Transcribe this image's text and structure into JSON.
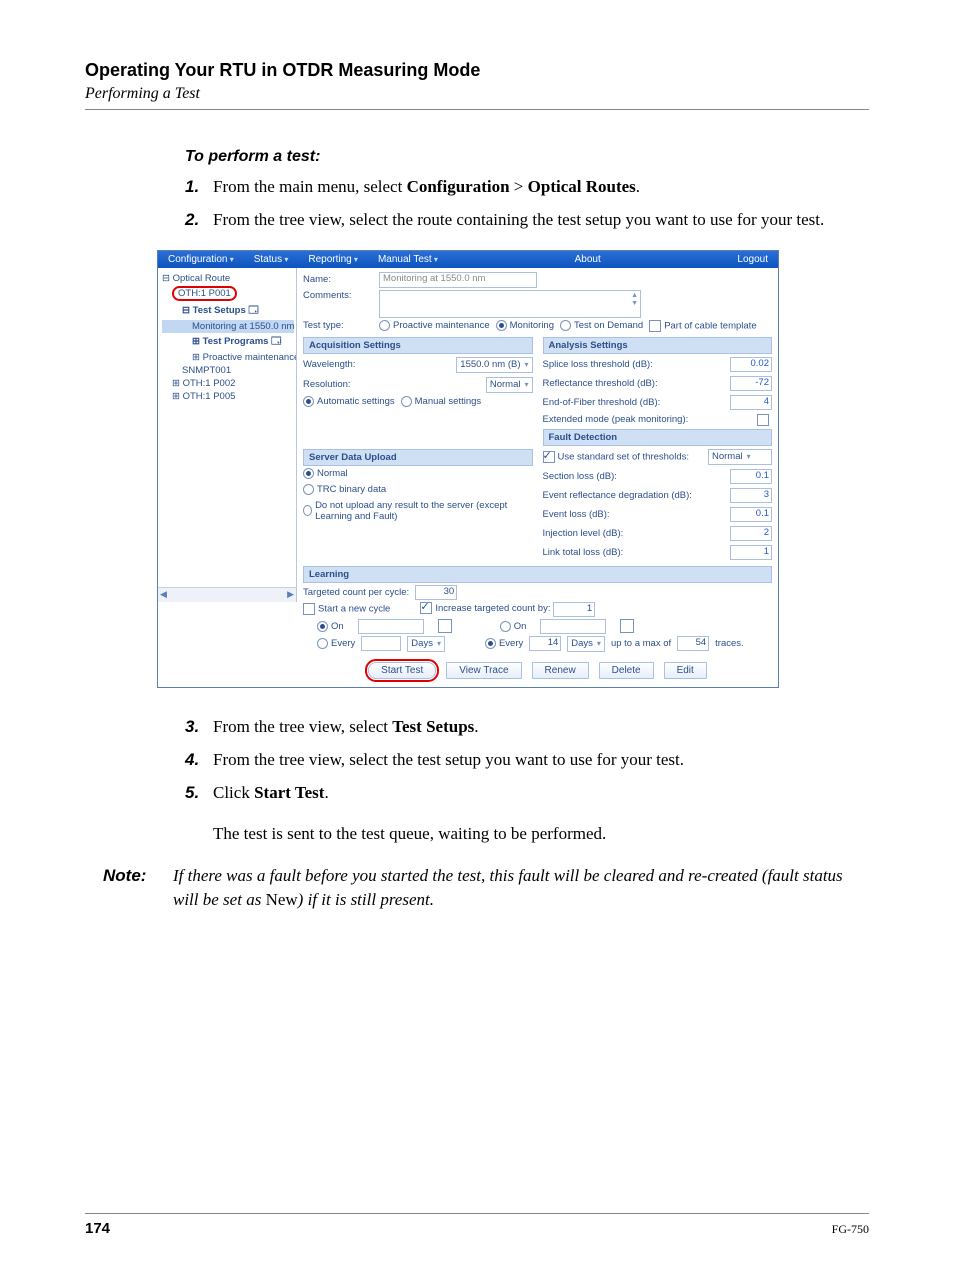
{
  "header": {
    "chapter": "Operating Your RTU in OTDR Measuring Mode",
    "section": "Performing a Test"
  },
  "procedure": {
    "title": "To perform a test:",
    "steps_top": [
      {
        "num": "1.",
        "pre": "From the main menu, select ",
        "b1": "Configuration",
        "mid": " > ",
        "b2": "Optical Routes",
        "post": "."
      },
      {
        "num": "2.",
        "pre": "From the tree view, select the route containing the test setup you want to use for your test.",
        "b1": "",
        "mid": "",
        "b2": "",
        "post": ""
      }
    ],
    "steps_bottom": [
      {
        "num": "3.",
        "pre": "From the tree view, select ",
        "b1": "Test Setups",
        "post": "."
      },
      {
        "num": "4.",
        "pre": "From the tree view, select the test setup you want to use for your test."
      },
      {
        "num": "5.",
        "pre": "Click ",
        "b1": "Start Test",
        "post": "."
      }
    ],
    "result": "The test is sent to the test queue, waiting to be performed."
  },
  "note": {
    "label": "Note:",
    "body_ital_1": "If there was a fault before you started the test, this fault will be cleared and re-created (fault status will be set as ",
    "body_roman": "New",
    "body_ital_2": ") if it is still present."
  },
  "app": {
    "menu": [
      "Configuration",
      "Status",
      "Reporting",
      "Manual Test",
      "About",
      "Logout"
    ],
    "tree": {
      "root": "Optical Route",
      "p001": "OTH:1 P001",
      "test_setups": "Test Setups",
      "monitoring": "Monitoring at 1550.0 nm",
      "test_programs": "Test Programs",
      "proactive": "Proactive maintenance at",
      "snmp": "SNMPT001",
      "p002": "OTH:1 P002",
      "p005": "OTH:1 P005"
    },
    "name_label": "Name:",
    "name_value": "Monitoring at 1550.0 nm",
    "comments_label": "Comments:",
    "testtype_label": "Test type:",
    "testtypes": {
      "proactive": "Proactive maintenance",
      "monitoring": "Monitoring",
      "ondemand": "Test on Demand",
      "template": "Part of cable template"
    },
    "acq_hdr": "Acquisition Settings",
    "wavelength_label": "Wavelength:",
    "wavelength_value": "1550.0 nm (B)",
    "resolution_label": "Resolution:",
    "resolution_value": "Normal",
    "auto": "Automatic settings",
    "manual": "Manual settings",
    "upload_hdr": "Server Data Upload",
    "upload_normal": "Normal",
    "upload_trc": "TRC binary data",
    "upload_none": "Do not upload any result to the server (except Learning and Fault)",
    "learning_hdr": "Learning",
    "targeted_label": "Targeted count per cycle:",
    "targeted_value": "30",
    "start_cycle": "Start a new cycle",
    "increase_label": "Increase targeted count by:",
    "increase_value": "1",
    "on_label": "On",
    "every_label": "Every",
    "every_value": "14",
    "days_unit": "Days",
    "uptomax": "up to a max of",
    "uptomax_value": "54",
    "traces": "traces.",
    "analysis_hdr": "Analysis Settings",
    "splice_loss": "Splice loss threshold (dB):",
    "splice_loss_v": "0.02",
    "reflectance": "Reflectance threshold (dB):",
    "reflectance_v": "-72",
    "eof": "End-of-Fiber threshold (dB):",
    "eof_v": "4",
    "extended": "Extended mode (peak monitoring):",
    "fault_hdr": "Fault Detection",
    "use_std": "Use standard set of thresholds:",
    "use_std_v": "Normal",
    "section_loss": "Section loss (dB):",
    "section_loss_v": "0.1",
    "evt_refl": "Event reflectance degradation (dB):",
    "evt_refl_v": "3",
    "evt_loss": "Event loss (dB):",
    "evt_loss_v": "0.1",
    "injection": "Injection level (dB):",
    "injection_v": "2",
    "link_total": "Link total loss (dB):",
    "link_total_v": "1",
    "buttons": {
      "start": "Start Test",
      "view": "View Trace",
      "renew": "Renew",
      "delete": "Delete",
      "edit": "Edit"
    }
  },
  "footer": {
    "page": "174",
    "doc": "FG-750"
  }
}
